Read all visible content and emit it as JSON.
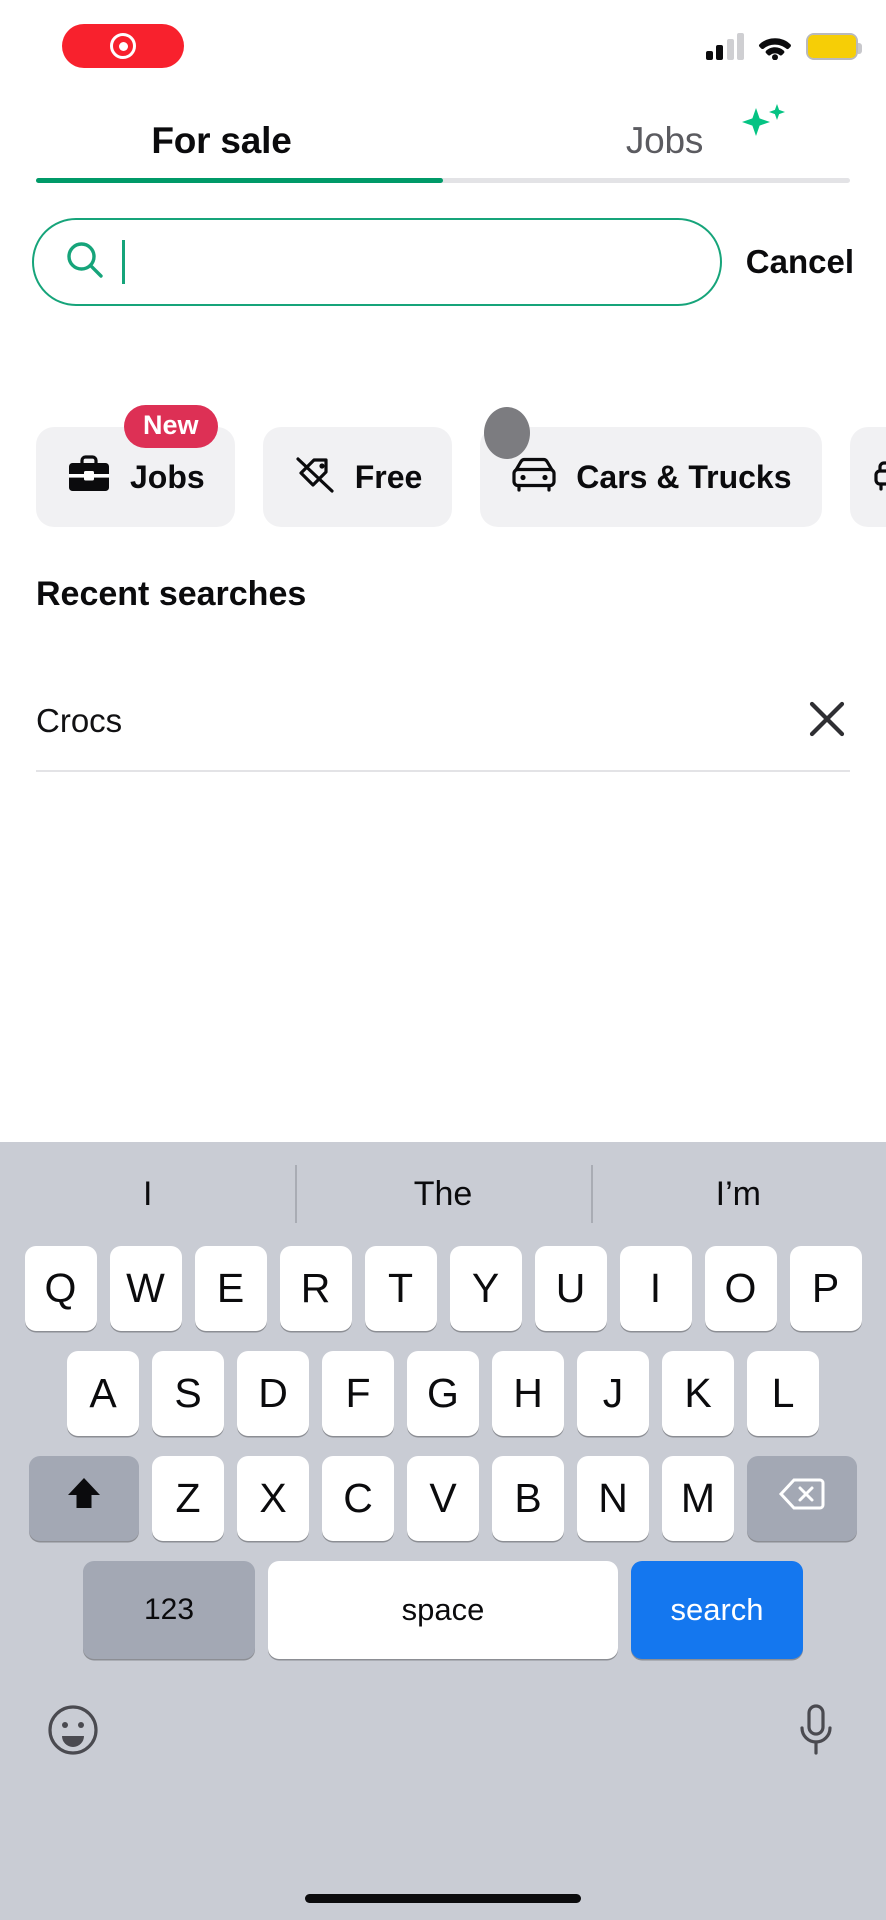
{
  "status_bar": {
    "recording_indicator": "screen-recording-active",
    "cellular_bars_filled": 2,
    "cellular_bars_total": 4,
    "wifi": "wifi-icon",
    "battery_state": "low-power-mode-yellow"
  },
  "tabs": [
    {
      "label": "For sale",
      "active": true
    },
    {
      "label": "Jobs",
      "active": false,
      "icon": "sparkles-icon"
    }
  ],
  "search": {
    "value": "",
    "placeholder": "",
    "icon": "search-icon",
    "cancel_label": "Cancel"
  },
  "category_chips": [
    {
      "label": "Jobs",
      "icon": "briefcase-icon",
      "badge": "New"
    },
    {
      "label": "Free",
      "icon": "tag-slash-icon",
      "badge": ""
    },
    {
      "label": "Cars & Trucks",
      "icon": "car-icon",
      "badge": ""
    },
    {
      "label": "",
      "icon": "sofa-icon",
      "badge": ""
    }
  ],
  "recent": {
    "heading": "Recent searches",
    "items": [
      {
        "text": "Crocs",
        "remove_icon": "close-icon"
      }
    ]
  },
  "keyboard": {
    "suggestions": [
      "I",
      "The",
      "I’m"
    ],
    "row1": [
      "Q",
      "W",
      "E",
      "R",
      "T",
      "Y",
      "U",
      "I",
      "O",
      "P"
    ],
    "row2": [
      "A",
      "S",
      "D",
      "F",
      "G",
      "H",
      "J",
      "K",
      "L"
    ],
    "row3": [
      "Z",
      "X",
      "C",
      "V",
      "B",
      "N",
      "M"
    ],
    "shift_icon": "shift-icon",
    "backspace_icon": "backspace-icon",
    "numbers_label": "123",
    "space_label": "space",
    "return_label": "search",
    "emoji_icon": "emoji-icon",
    "mic_icon": "microphone-icon"
  },
  "colors": {
    "brand_green": "#009a68",
    "search_border": "#16a47a",
    "badge_pink": "#dd3055",
    "record_red": "#f8212d",
    "battery_yellow": "#f6ce06",
    "return_blue": "#1477ef",
    "keyboard_bg": "#c9ccd4"
  }
}
